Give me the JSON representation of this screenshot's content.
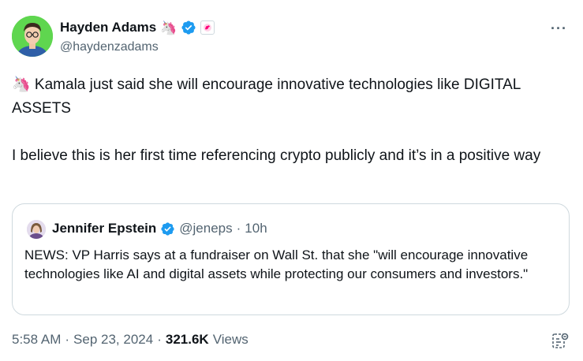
{
  "author": {
    "display_name": "Hayden Adams",
    "emoji": "🦄",
    "handle": "@haydenzadams"
  },
  "more_glyph": "···",
  "tweet": {
    "line1": "🦄 Kamala just said she will encourage innovative technologies like DIGITAL ASSETS",
    "line2": "I believe this is her first time referencing crypto publicly and it’s in a positive way"
  },
  "quote": {
    "name": "Jennifer Epstein",
    "handle": "@jeneps",
    "separator": "·",
    "time": "10h",
    "text": "NEWS: VP Harris says at a fundraiser on Wall St. that she \"will encourage innovative technologies like AI and digital assets while protecting our consumers and investors.\""
  },
  "footer": {
    "time": "5:58 AM",
    "sep1": "·",
    "date": "Sep 23, 2024",
    "sep2": "·",
    "views_count": "321.6K",
    "views_label": "Views"
  },
  "colors": {
    "verified": "#1d9bf0",
    "secondary_text": "#536471",
    "border": "#cfd9de",
    "avatar_bg": "#5fd64f"
  },
  "icons": {
    "verified": "verified-badge-icon",
    "affiliate": "uniswap-affiliate-icon",
    "more": "more-icon",
    "analytics": "analytics-icon"
  }
}
